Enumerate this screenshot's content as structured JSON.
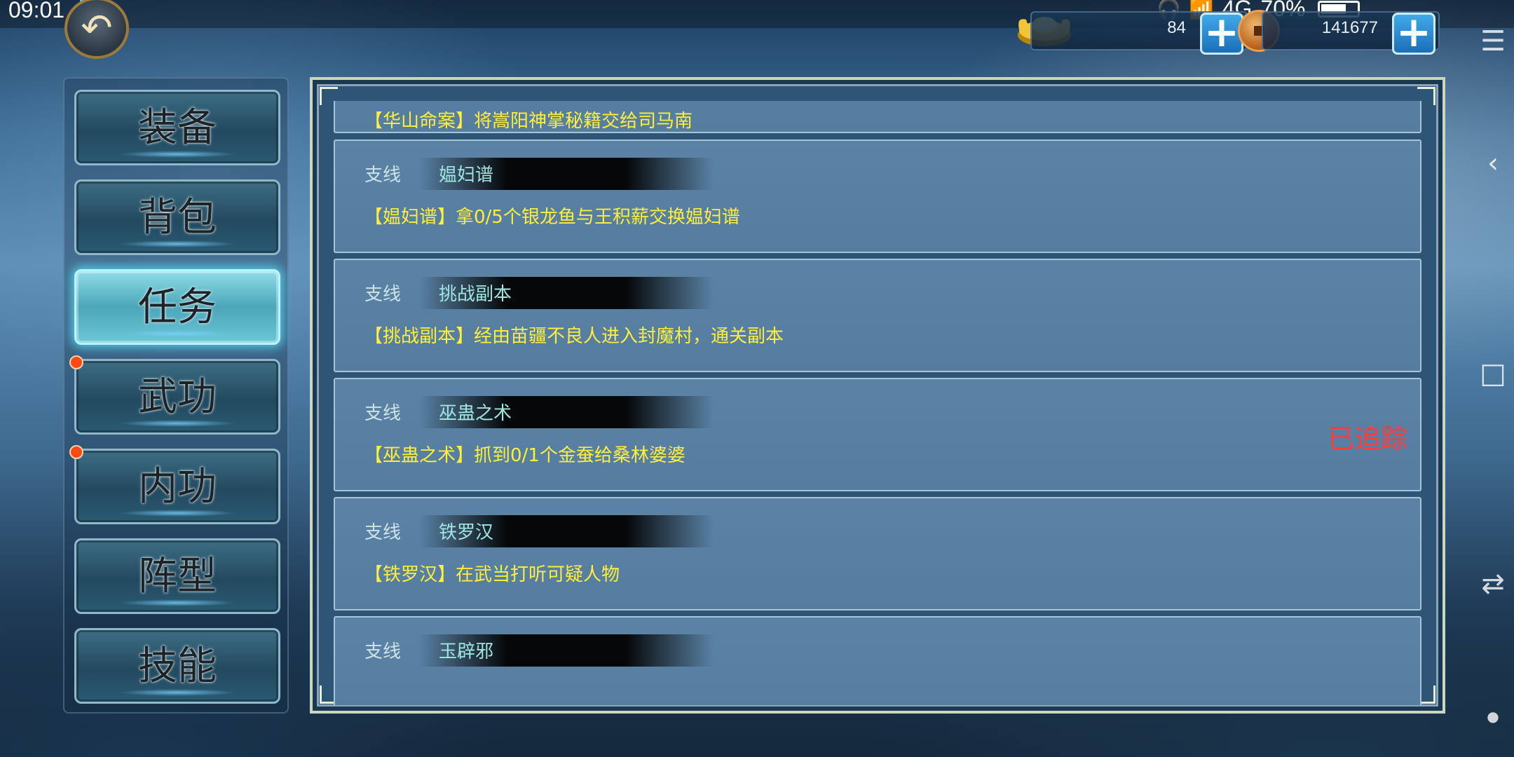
{
  "status": {
    "time": "09:01",
    "network": "4G",
    "battery": "70%",
    "battery_level": 0.7
  },
  "currency": {
    "gold": "84",
    "coins": "141677"
  },
  "menu": [
    {
      "label": "装备",
      "active": false,
      "badge": false
    },
    {
      "label": "背包",
      "active": false,
      "badge": false
    },
    {
      "label": "任务",
      "active": true,
      "badge": false
    },
    {
      "label": "武功",
      "active": false,
      "badge": true
    },
    {
      "label": "内功",
      "active": false,
      "badge": true
    },
    {
      "label": "阵型",
      "active": false,
      "badge": false
    },
    {
      "label": "技能",
      "active": false,
      "badge": false
    }
  ],
  "quests": [
    {
      "type": "",
      "name": "",
      "desc": "【华山命案】将嵩阳神掌秘籍交给司马南",
      "tracked": ""
    },
    {
      "type": "支线",
      "name": "媪妇谱",
      "desc": "【媪妇谱】拿0/5个银龙鱼与王积薪交换媪妇谱",
      "tracked": ""
    },
    {
      "type": "支线",
      "name": "挑战副本",
      "desc": "【挑战副本】经由苗疆不良人进入封魔村，通关副本",
      "tracked": ""
    },
    {
      "type": "支线",
      "name": "巫蛊之术",
      "desc": "【巫蛊之术】抓到0/1个金蚕给桑林婆婆",
      "tracked": "已追踪"
    },
    {
      "type": "支线",
      "name": "铁罗汉",
      "desc": "【铁罗汉】在武当打听可疑人物",
      "tracked": ""
    },
    {
      "type": "支线",
      "name": "玉辟邪",
      "desc": "",
      "tracked": ""
    }
  ]
}
